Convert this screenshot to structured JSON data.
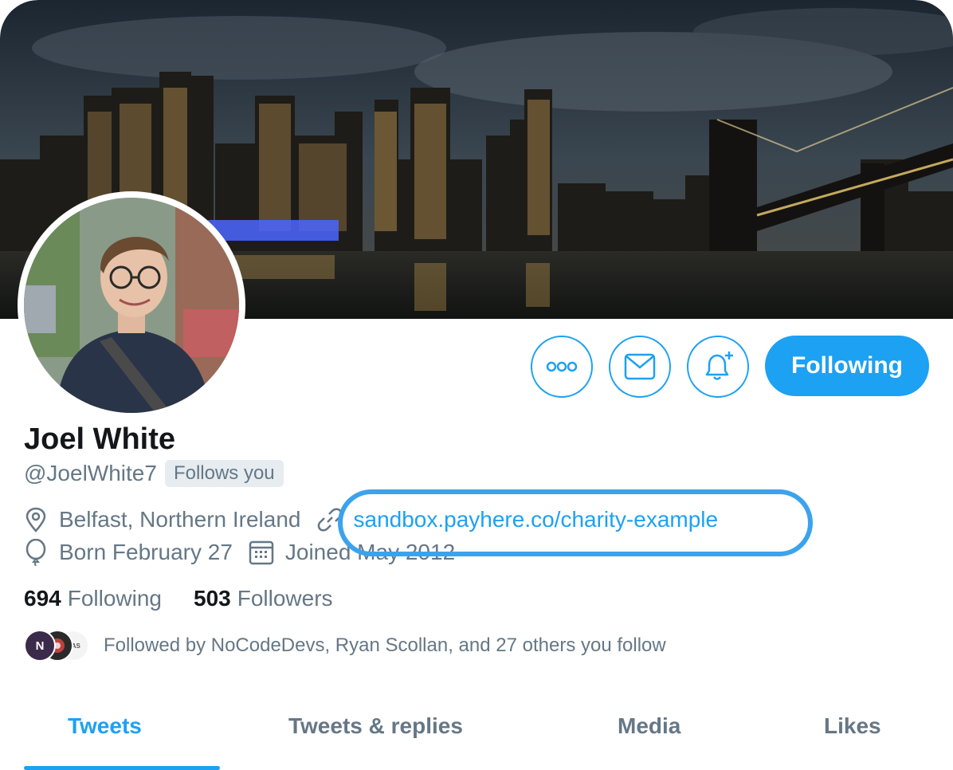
{
  "profile": {
    "display_name": "Joel White",
    "handle": "@JoelWhite7",
    "follows_you_badge": "Follows you",
    "location": "Belfast, Northern Ireland",
    "website": "sandbox.payhere.co/charity-example",
    "birthday": "Born February 27",
    "joined": "Joined May 2012"
  },
  "actions": {
    "more_icon": "more-horizontal-icon",
    "message_icon": "envelope-icon",
    "notify_icon": "bell-plus-icon",
    "follow_label": "Following"
  },
  "stats": {
    "following_count": "694",
    "following_label": "Following",
    "followers_count": "503",
    "followers_label": "Followers"
  },
  "followed_by": {
    "text": "Followed by NoCodeDevs, Ryan Scollan, and 27 others you follow",
    "avatar1_text": "N",
    "avatar3_text": "ITAS"
  },
  "tabs": [
    {
      "label": "Tweets",
      "active": true
    },
    {
      "label": "Tweets & replies",
      "active": false
    },
    {
      "label": "Media",
      "active": false
    },
    {
      "label": "Likes",
      "active": false
    }
  ],
  "colors": {
    "accent": "#1da1f2",
    "muted_text": "#657786",
    "primary_text": "#14171a",
    "highlight_ring": "#3ba3ee"
  }
}
